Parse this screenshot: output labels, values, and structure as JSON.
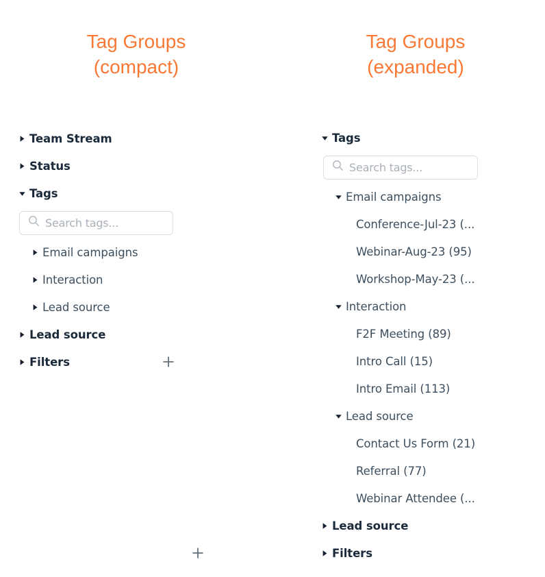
{
  "panels": [
    {
      "title": "Tag Groups\n(compact)",
      "search": {
        "placeholder": "Search tags...",
        "icon": "search-icon"
      },
      "rows": [
        {
          "label": "Team Stream",
          "level": 1,
          "caret": "right"
        },
        {
          "label": "Status",
          "level": 1,
          "caret": "right"
        },
        {
          "label": "Tags",
          "level": 1,
          "caret": "down"
        },
        {
          "type": "search"
        },
        {
          "label": "Email campaigns",
          "level": 2,
          "caret": "right"
        },
        {
          "label": "Interaction",
          "level": 2,
          "caret": "right"
        },
        {
          "label": "Lead source",
          "level": 2,
          "caret": "right"
        },
        {
          "label": "Lead source",
          "level": 1,
          "caret": "right"
        },
        {
          "label": "Filters",
          "level": 1,
          "caret": "right",
          "action": "add"
        }
      ]
    },
    {
      "title": "Tag Groups\n(expanded)",
      "search": {
        "placeholder": "Search tags...",
        "icon": "search-icon"
      },
      "rows": [
        {
          "label": "Tags",
          "level": 1,
          "caret": "down"
        },
        {
          "type": "search"
        },
        {
          "label": "Email campaigns",
          "level": 2,
          "caret": "down"
        },
        {
          "label": "Conference-Jul-23 (...",
          "level": 3,
          "caret": "none"
        },
        {
          "label": "Webinar-Aug-23 (95)",
          "level": 3,
          "caret": "none"
        },
        {
          "label": "Workshop-May-23 (...",
          "level": 3,
          "caret": "none"
        },
        {
          "label": "Interaction",
          "level": 2,
          "caret": "down"
        },
        {
          "label": "F2F Meeting (89)",
          "level": 3,
          "caret": "none"
        },
        {
          "label": "Intro Call (15)",
          "level": 3,
          "caret": "none"
        },
        {
          "label": "Intro Email (113)",
          "level": 3,
          "caret": "none"
        },
        {
          "label": "Lead source",
          "level": 2,
          "caret": "down"
        },
        {
          "label": "Contact Us Form (21)",
          "level": 3,
          "caret": "none"
        },
        {
          "label": "Referral (77)",
          "level": 3,
          "caret": "none"
        },
        {
          "label": "Webinar Attendee (...",
          "level": 3,
          "caret": "none"
        },
        {
          "label": "Lead source",
          "level": 1,
          "caret": "right"
        },
        {
          "label": "Filters",
          "level": 1,
          "caret": "right",
          "action": "add"
        }
      ]
    }
  ],
  "icons": {
    "add": "plus-icon",
    "caret_right": "caret-right-icon",
    "caret_down": "caret-down-icon"
  },
  "colors": {
    "title": "#f97833",
    "heading_text": "#1b2a3a",
    "item_text": "#3d4f5f",
    "placeholder": "#a9b0b8",
    "border": "#dcdfe3",
    "plus": "#5d6a75",
    "background": "#ffffff"
  }
}
